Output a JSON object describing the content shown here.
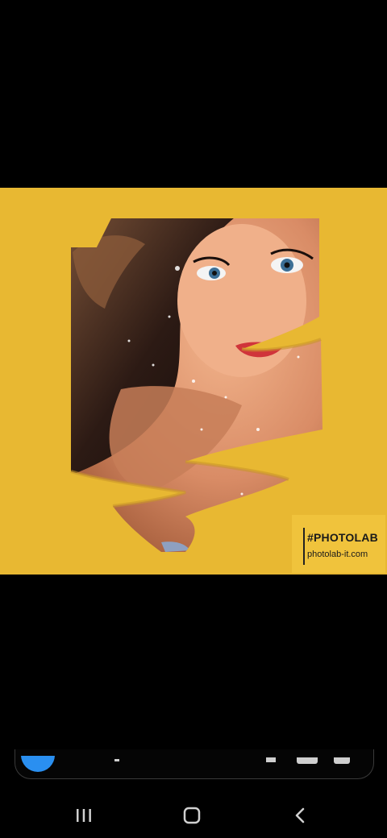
{
  "image": {
    "background_color": "#e8b832",
    "watermark": {
      "tag": "#PHOTOLAB",
      "url": "photolab-it.com"
    }
  },
  "bottom_sheet": {
    "accent_color": "#2a8ff0"
  },
  "nav_bar": {
    "buttons": [
      {
        "name": "recent-apps",
        "icon": "recent-apps-icon"
      },
      {
        "name": "home",
        "icon": "home-icon"
      },
      {
        "name": "back",
        "icon": "back-icon"
      }
    ]
  }
}
